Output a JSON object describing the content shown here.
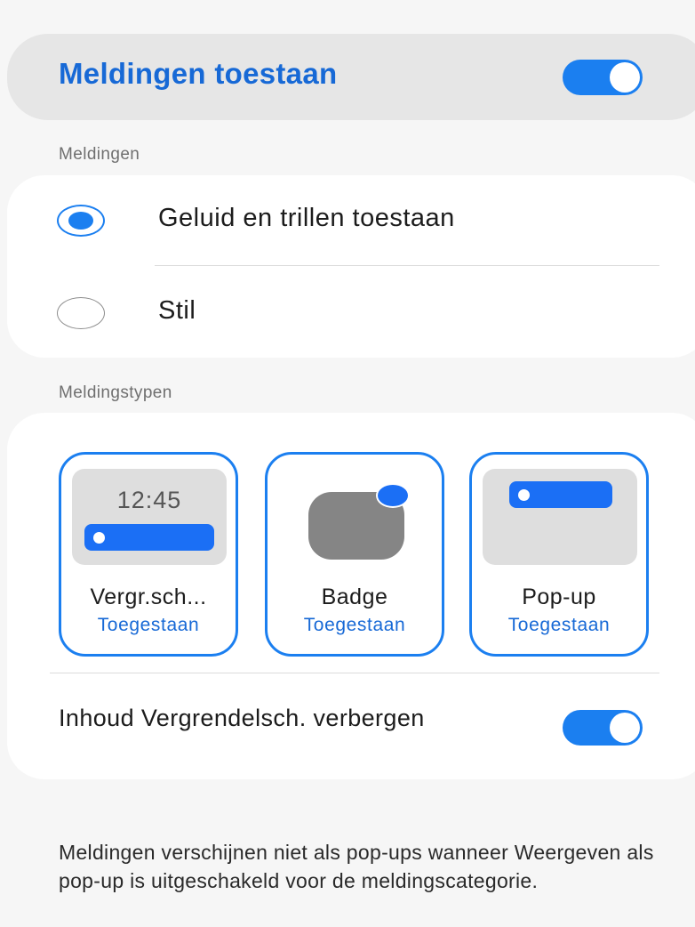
{
  "master": {
    "title": "Meldingen toestaan",
    "enabled": true
  },
  "alerts_section": {
    "label": "Meldingen",
    "options": [
      {
        "label": "Geluid en trillen toestaan",
        "selected": true
      },
      {
        "label": "Stil",
        "selected": false
      }
    ]
  },
  "types_section": {
    "label": "Meldingstypen",
    "tiles": [
      {
        "name": "Vergr.sch...",
        "status": "Toegestaan",
        "preview_time": "12:45",
        "icon": "lock-screen-preview-icon"
      },
      {
        "name": "Badge",
        "status": "Toegestaan",
        "icon": "badge-preview-icon"
      },
      {
        "name": "Pop-up",
        "status": "Toegestaan",
        "icon": "popup-preview-icon"
      }
    ]
  },
  "hide_content": {
    "label": "Inhoud Vergrendelsch. verbergen",
    "enabled": true
  },
  "footer_note": "Meldingen verschijnen niet als pop-ups wanneer Weergeven als pop-up is uitgeschakeld voor de meldingscategorie.",
  "colors": {
    "accent": "#1b7ff0",
    "title_blue": "#1769d6",
    "background": "#f6f6f6",
    "card": "#ffffff"
  }
}
